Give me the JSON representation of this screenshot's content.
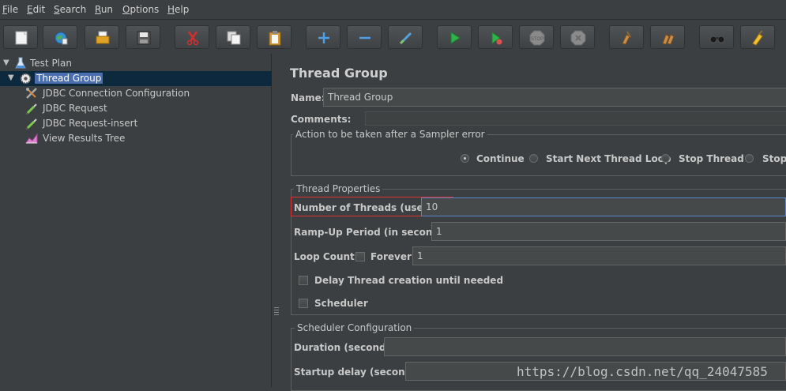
{
  "menu": [
    {
      "mnemonic": "F",
      "rest": "ile"
    },
    {
      "mnemonic": "E",
      "rest": "dit"
    },
    {
      "mnemonic": "S",
      "rest": "earch"
    },
    {
      "mnemonic": "R",
      "rest": "un"
    },
    {
      "mnemonic": "O",
      "rest": "ptions"
    },
    {
      "mnemonic": "H",
      "rest": "elp"
    }
  ],
  "toolbar": [
    "new-icon",
    "templates-icon",
    "open-icon",
    "save-icon",
    "cut-icon",
    "copy-icon",
    "paste-icon",
    "expand-icon",
    "collapse-icon",
    "toggle-icon",
    "start-icon",
    "start-no-pause-icon",
    "stop-icon",
    "shutdown-icon",
    "clear-icon",
    "clear-all-icon",
    "search-icon",
    "reset-search-icon"
  ],
  "tree": {
    "items": [
      {
        "label": "Test Plan",
        "icon": "test-plan-icon"
      },
      {
        "label": "Thread Group",
        "icon": "thread-group-icon",
        "selected": true
      },
      {
        "label": "JDBC Connection Configuration",
        "icon": "config-element-icon"
      },
      {
        "label": "JDBC Request",
        "icon": "sampler-icon"
      },
      {
        "label": "JDBC Request-insert",
        "icon": "sampler-icon"
      },
      {
        "label": "View Results Tree",
        "icon": "listener-icon"
      }
    ]
  },
  "panel": {
    "title": "Thread Group",
    "name_label": "Name:",
    "name_value": "Thread Group",
    "comments_label": "Comments:",
    "sampler_error": {
      "title": "Action to be taken after a Sampler error",
      "options": [
        "Continue",
        "Start Next Thread Loop",
        "Stop Thread",
        "Stop T"
      ],
      "selected": "Continue"
    },
    "thread_properties": {
      "title": "Thread Properties",
      "threads_label": "Number of Threads (users):",
      "threads_value": "10",
      "rampup_label": "Ramp-Up Period (in seconds):",
      "rampup_value": "1",
      "loop_label": "Loop Count:",
      "forever_label": "Forever",
      "forever_checked": false,
      "loop_value": "1",
      "delay_label": "Delay Thread creation until needed",
      "delay_checked": false,
      "scheduler_label": "Scheduler",
      "scheduler_checked": false
    },
    "scheduler_config": {
      "title": "Scheduler Configuration",
      "duration_label": "Duration (seconds)",
      "duration_value": "",
      "startup_label": "Startup delay (seconds)",
      "startup_value": ""
    }
  },
  "watermark": "https://blog.csdn.net/qq_24047585",
  "colors": {
    "background": "#3c3f41",
    "selection": "#4b6eaf",
    "highlight": "#e03030"
  }
}
